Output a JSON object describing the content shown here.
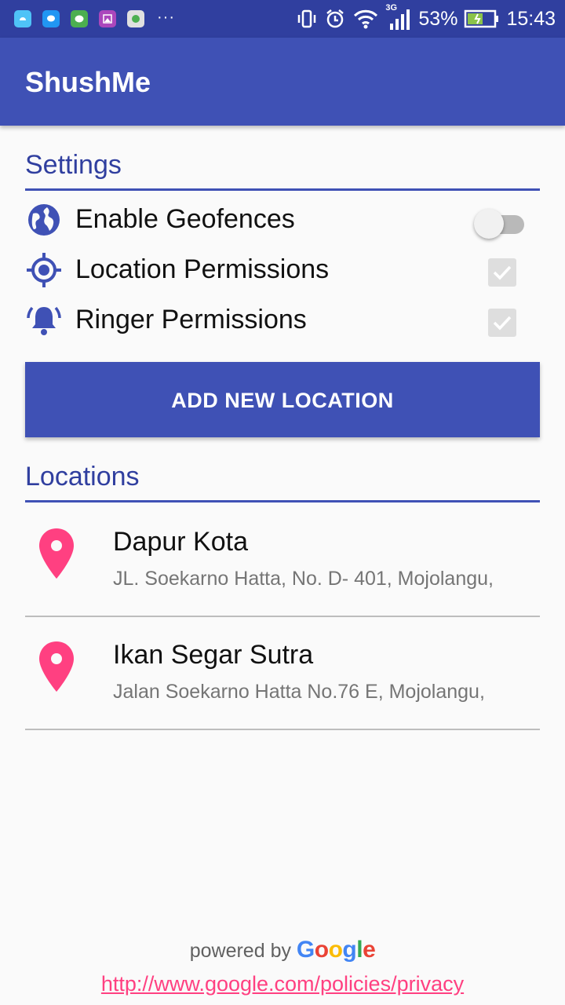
{
  "status_bar": {
    "notification_icons": [
      "android-icon",
      "messages-icon",
      "line-icon",
      "gallery-icon",
      "whatsapp-icon"
    ],
    "more": "···",
    "network_type": "3G",
    "battery": "53%",
    "time": "15:43"
  },
  "app_bar": {
    "title": "ShushMe"
  },
  "settings": {
    "title": "Settings",
    "items": [
      {
        "label": "Enable Geofences",
        "control": "toggle",
        "checked": false
      },
      {
        "label": "Location Permissions",
        "control": "checkbox",
        "checked": true
      },
      {
        "label": "Ringer Permissions",
        "control": "checkbox",
        "checked": true
      }
    ]
  },
  "add_button": {
    "label": "ADD NEW LOCATION"
  },
  "locations": {
    "title": "Locations",
    "items": [
      {
        "name": "Dapur Kota",
        "address": "JL. Soekarno Hatta, No. D- 401, Mojolangu,"
      },
      {
        "name": "Ikan Segar Sutra",
        "address": "Jalan Soekarno Hatta No.76 E, Mojolangu,"
      }
    ]
  },
  "footer": {
    "powered_by": "powered by",
    "google": "Google",
    "privacy_link": "http://www.google.com/policies/privacy"
  },
  "colors": {
    "primary": "#3f51b5",
    "primary_dark": "#303f9f",
    "accent": "#ff4081",
    "background": "#fafafa"
  }
}
